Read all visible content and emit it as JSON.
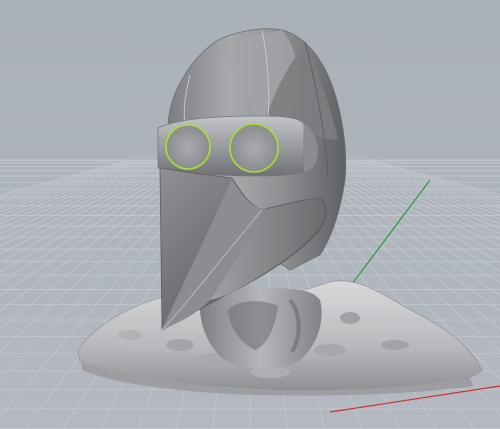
{
  "viewport": {
    "view_name": "Perspective",
    "background_color": "#a9afb7",
    "grid_color": "#c3c8cf",
    "grid_major_color": "#b9bec6",
    "x_axis_color": "#c9312c",
    "y_axis_color": "#2e9b3a",
    "selection_highlight_color": "#a7e02f"
  },
  "model": {
    "name": "plague-doctor-mask-bust",
    "parts": [
      "hood",
      "goggle-band",
      "left-lens",
      "right-lens",
      "beak",
      "neck",
      "base"
    ]
  }
}
